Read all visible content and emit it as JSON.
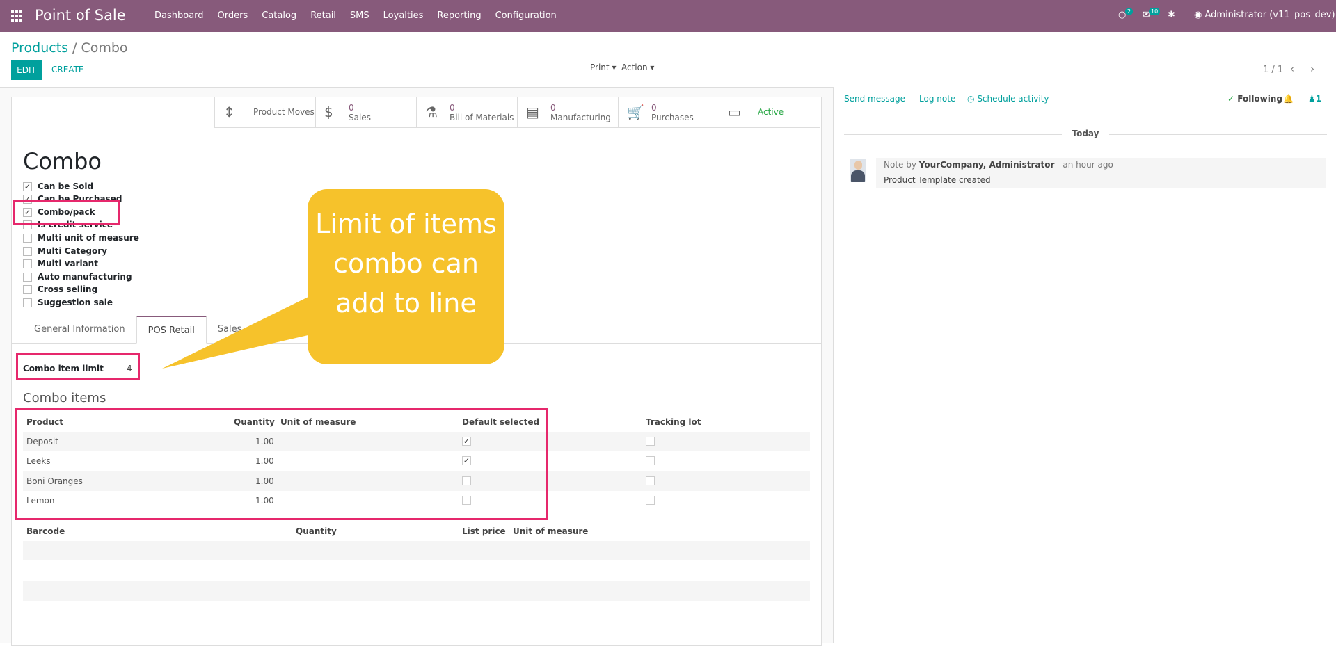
{
  "app": {
    "name": "Point of Sale"
  },
  "menu": [
    "Dashboard",
    "Orders",
    "Catalog",
    "Retail",
    "SMS",
    "Loyalties",
    "Reporting",
    "Configuration"
  ],
  "systray": {
    "activity_count": "2",
    "message_count": "10",
    "user": "Administrator (v11_pos_dev)"
  },
  "breadcrumb": {
    "parent": "Products",
    "sep": "/",
    "current": "Combo"
  },
  "buttons": {
    "edit": "EDIT",
    "create": "CREATE",
    "print": "Print",
    "action": "Action"
  },
  "pager": "1 / 1",
  "smart_buttons": [
    {
      "number": "",
      "label": "Product Moves"
    },
    {
      "number": "0",
      "label": "Sales"
    },
    {
      "number": "0",
      "label": "Bill of Materials"
    },
    {
      "number": "0",
      "label": "Manufacturing"
    },
    {
      "number": "0",
      "label": "Purchases"
    },
    {
      "number": "",
      "label": "Active"
    }
  ],
  "product": {
    "name": "Combo"
  },
  "checkboxes": [
    {
      "label": "Can be Sold",
      "checked": true
    },
    {
      "label": "Can be Purchased",
      "checked": true
    },
    {
      "label": "Combo/pack",
      "checked": true
    },
    {
      "label": "Is credit service",
      "checked": false
    },
    {
      "label": "Multi unit of measure",
      "checked": false
    },
    {
      "label": "Multi Category",
      "checked": false
    },
    {
      "label": "Multi variant",
      "checked": false
    },
    {
      "label": "Auto manufacturing",
      "checked": false
    },
    {
      "label": "Cross selling",
      "checked": false
    },
    {
      "label": "Suggestion sale",
      "checked": false
    }
  ],
  "tabs": [
    "General Information",
    "POS Retail",
    "Sales"
  ],
  "combo_limit": {
    "label": "Combo item limit",
    "value": "4"
  },
  "combo_items": {
    "title": "Combo items",
    "headers": {
      "product": "Product",
      "quantity": "Quantity",
      "uom": "Unit of measure",
      "default": "Default selected",
      "tracking": "Tracking lot"
    },
    "rows": [
      {
        "product": "Deposit",
        "quantity": "1.00",
        "default": true,
        "tracking": false
      },
      {
        "product": "Leeks",
        "quantity": "1.00",
        "default": true,
        "tracking": false
      },
      {
        "product": "Boni Oranges",
        "quantity": "1.00",
        "default": false,
        "tracking": false
      },
      {
        "product": "Lemon",
        "quantity": "1.00",
        "default": false,
        "tracking": false
      }
    ]
  },
  "barcode_table": {
    "headers": {
      "barcode": "Barcode",
      "quantity": "Quantity",
      "price": "List price",
      "uom": "Unit of measure"
    }
  },
  "callout": {
    "text": "Limit of items combo can add to line"
  },
  "chatter": {
    "send_message": "Send message",
    "log_note": "Log note",
    "schedule": "Schedule activity",
    "following": "Following",
    "followers": "1",
    "today": "Today",
    "note_prefix": "Note by",
    "author": "YourCompany, Administrator",
    "time": "- an hour ago",
    "body": "Product Template created"
  },
  "colors": {
    "brand": "#875a7b",
    "accent": "#00a09d",
    "highlight": "#e6286c",
    "callout": "#f6c22b"
  }
}
